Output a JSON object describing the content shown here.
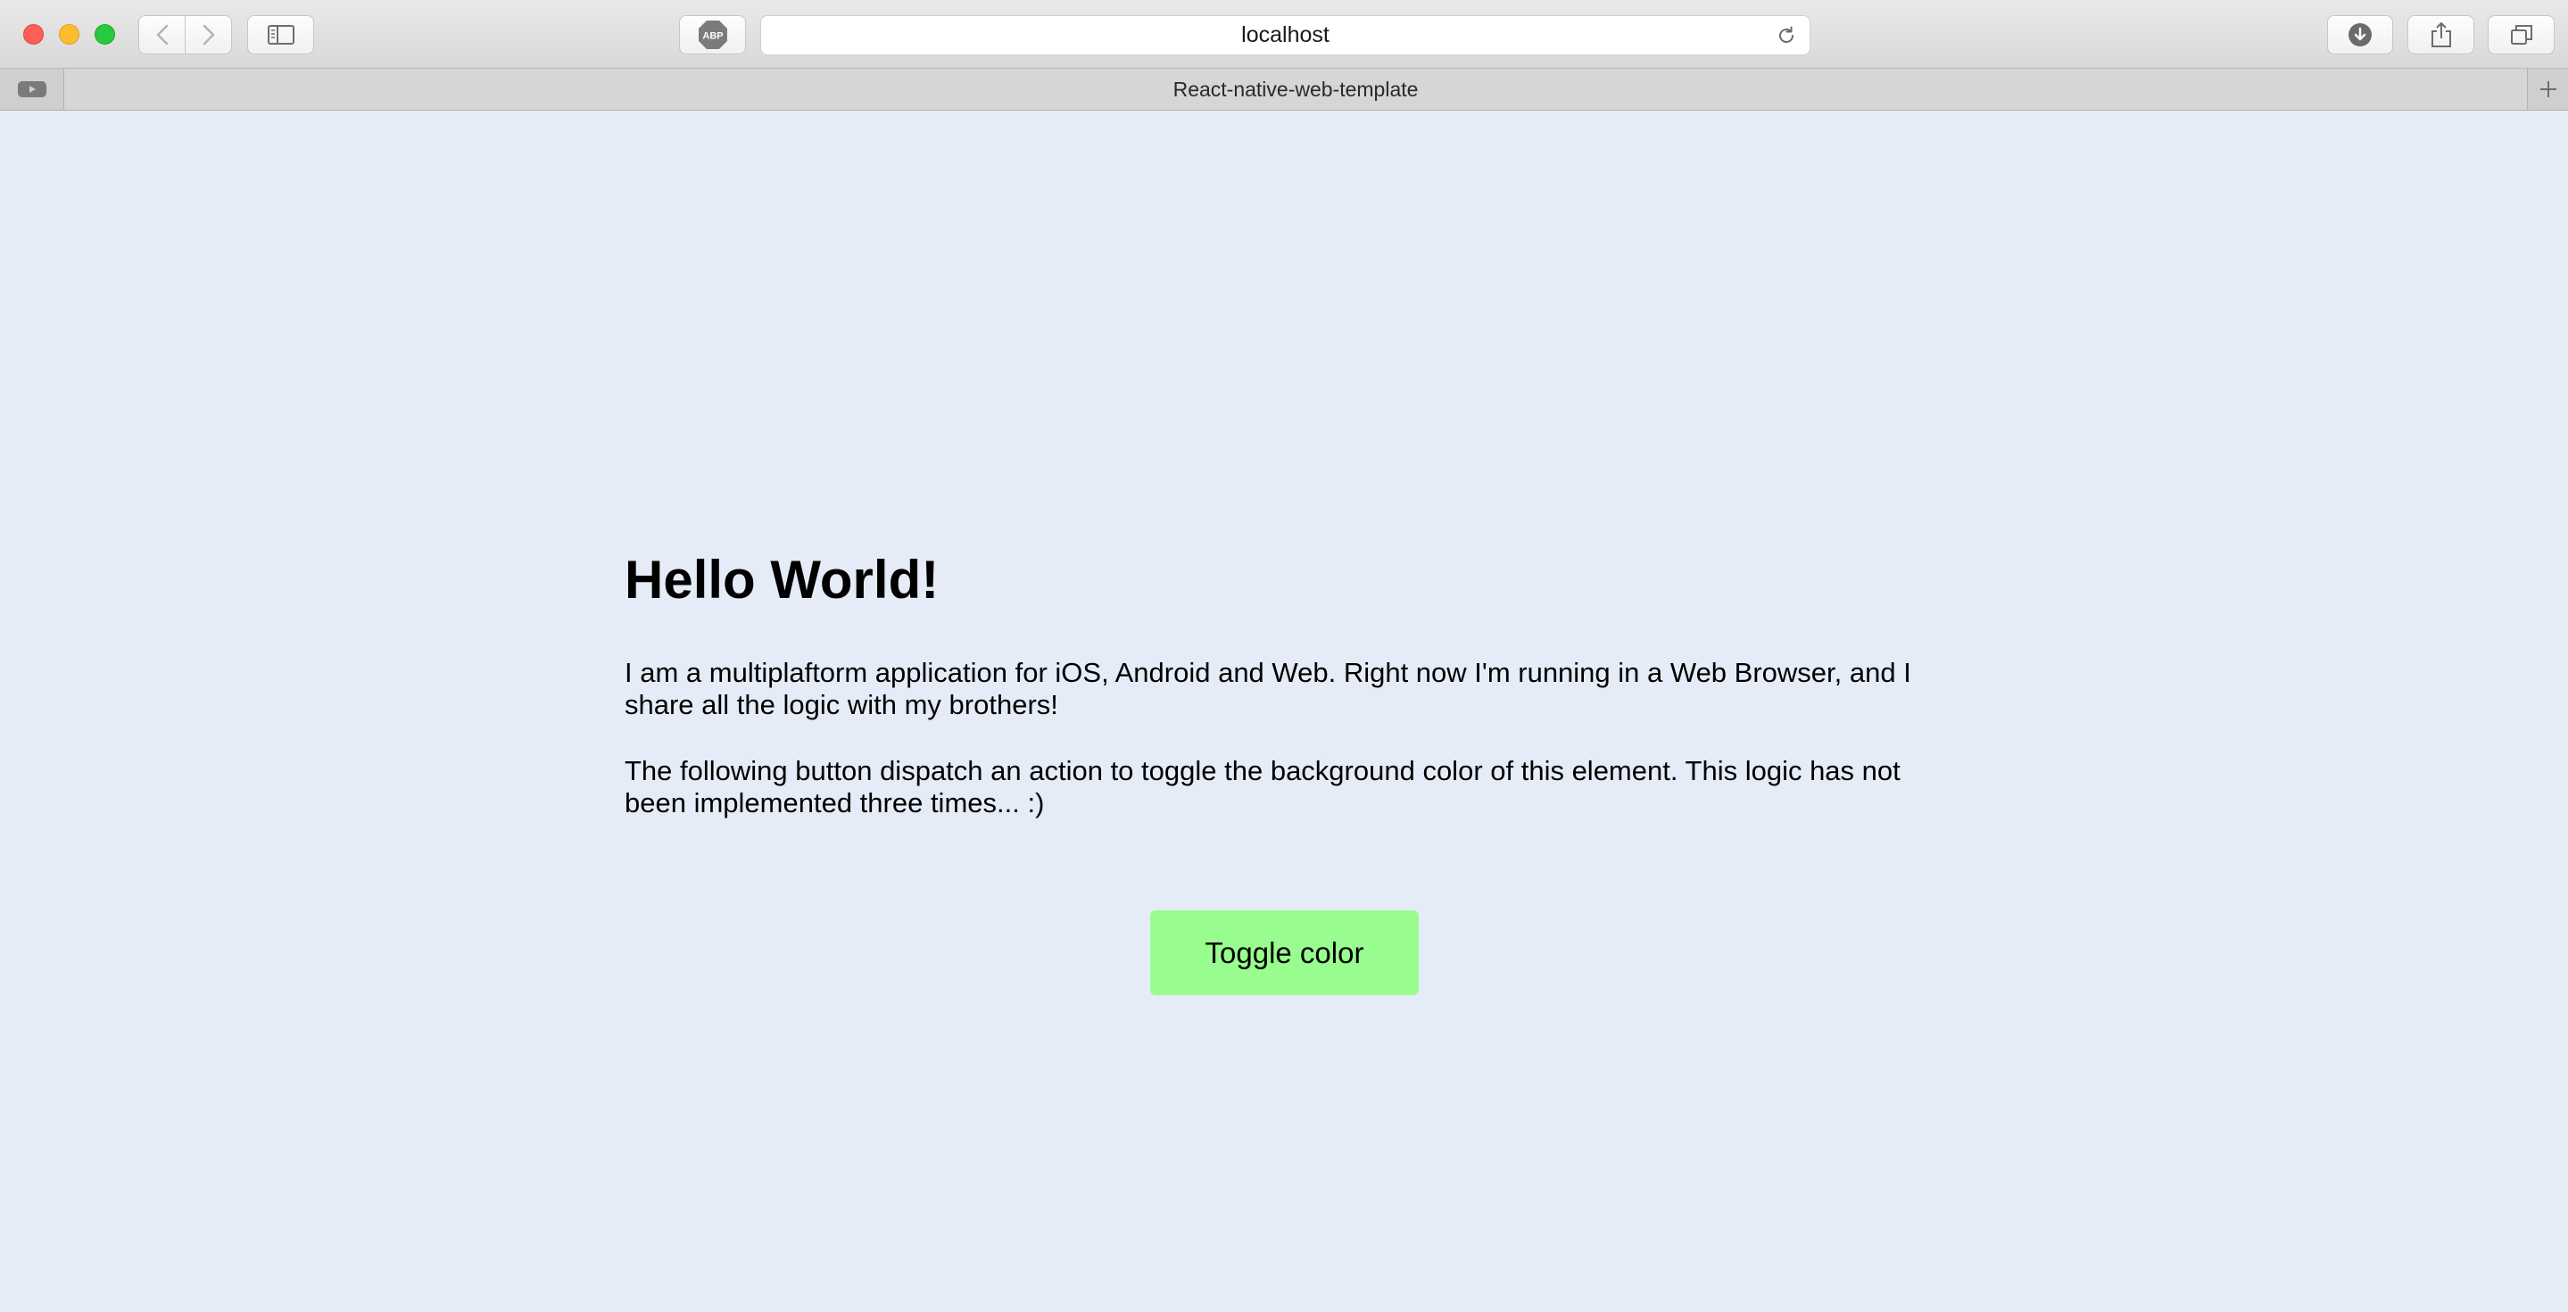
{
  "browser": {
    "address": {
      "url": "localhost"
    },
    "adblock_label": "ABP",
    "tabs": [
      {
        "title": "React-native-web-template"
      }
    ],
    "icons": {
      "back": "chevron-left-icon",
      "forward": "chevron-right-icon",
      "sidebar": "sidebar-icon",
      "adblock": "adblock-icon",
      "reload": "reload-icon",
      "downloads": "download-icon",
      "share": "share-icon",
      "tabs": "tabs-overview-icon",
      "new_tab": "plus-icon",
      "pinned": "video-icon"
    }
  },
  "page": {
    "heading": "Hello World!",
    "paragraph1": "I am a multiplaftorm application for iOS, Android and Web. Right now I'm running in a Web Browser, and I share all the logic with my brothers!",
    "paragraph2": "The following button dispatch an action to toggle the background color of this element. This logic has not been implemented three times... :)",
    "button_label": "Toggle color",
    "background_color": "#e5ecf7",
    "button_color": "#98fc8e"
  }
}
